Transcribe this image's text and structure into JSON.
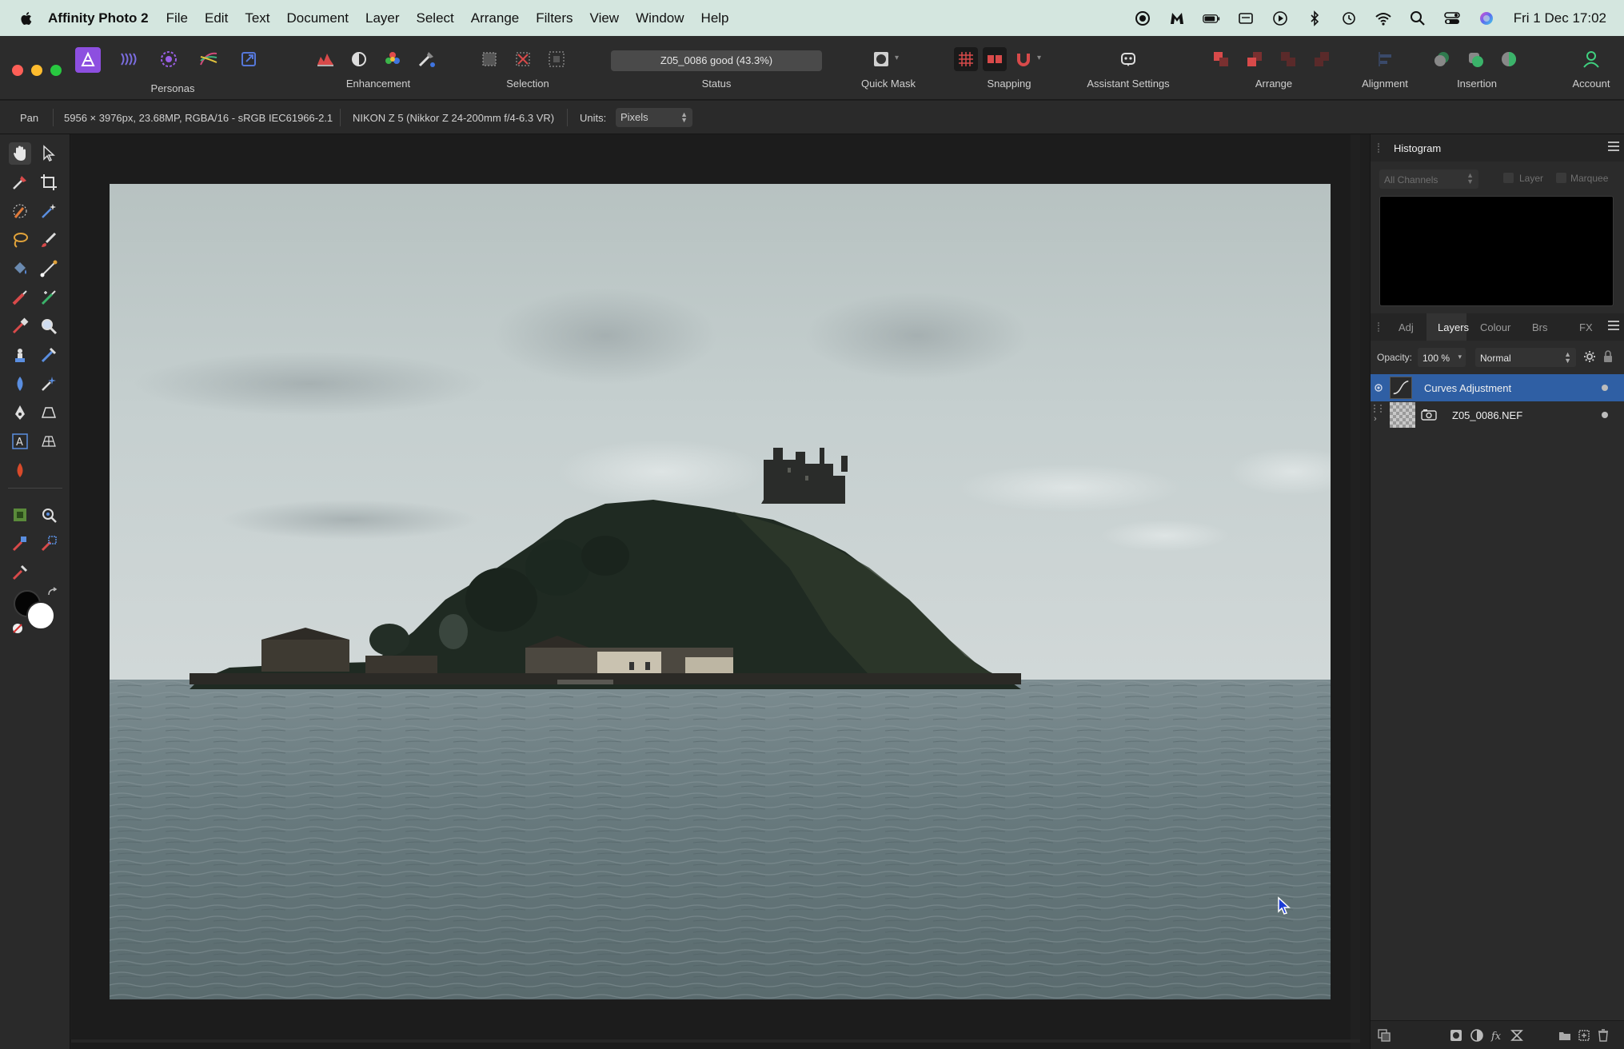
{
  "menubar": {
    "app_name": "Affinity Photo 2",
    "items": [
      "File",
      "Edit",
      "Text",
      "Document",
      "Layer",
      "Select",
      "Arrange",
      "Filters",
      "View",
      "Window",
      "Help"
    ],
    "clock": "Fri 1 Dec  17:02"
  },
  "toolbar": {
    "personas_label": "Personas",
    "enhancement_label": "Enhancement",
    "selection_label": "Selection",
    "status_label": "Status",
    "status_value": "Z05_0086 good (43.3%)",
    "quickmask_label": "Quick Mask",
    "snapping_label": "Snapping",
    "assistant_label": "Assistant Settings",
    "arrange_label": "Arrange",
    "alignment_label": "Alignment",
    "insertion_label": "Insertion",
    "account_label": "Account"
  },
  "context": {
    "tool_name": "Pan",
    "doc_info": "5956 × 3976px, 23.68MP, RGBA/16 - sRGB IEC61966-2.1",
    "camera_info": "NIKON Z 5 (Nikkor Z 24-200mm f/4-6.3 VR)",
    "units_label": "Units:",
    "units_value": "Pixels"
  },
  "histogram": {
    "title": "Histogram",
    "channel": "All Channels",
    "layer_label": "Layer",
    "marquee_label": "Marquee"
  },
  "layers_panel": {
    "tabs": [
      "Adj",
      "Layers",
      "Colour",
      "Brs",
      "FX"
    ],
    "active_tab": "Layers",
    "opacity_label": "Opacity:",
    "opacity_value": "100 %",
    "blend_mode": "Normal",
    "layers": [
      {
        "name": "Curves Adjustment",
        "selected": true
      },
      {
        "name": "Z05_0086.NEF",
        "selected": false
      }
    ]
  },
  "colors": {
    "menubar_bg": "#d4e6df",
    "selection_blue": "#2f5fa4",
    "accent_purple": "#8d4fe0"
  }
}
